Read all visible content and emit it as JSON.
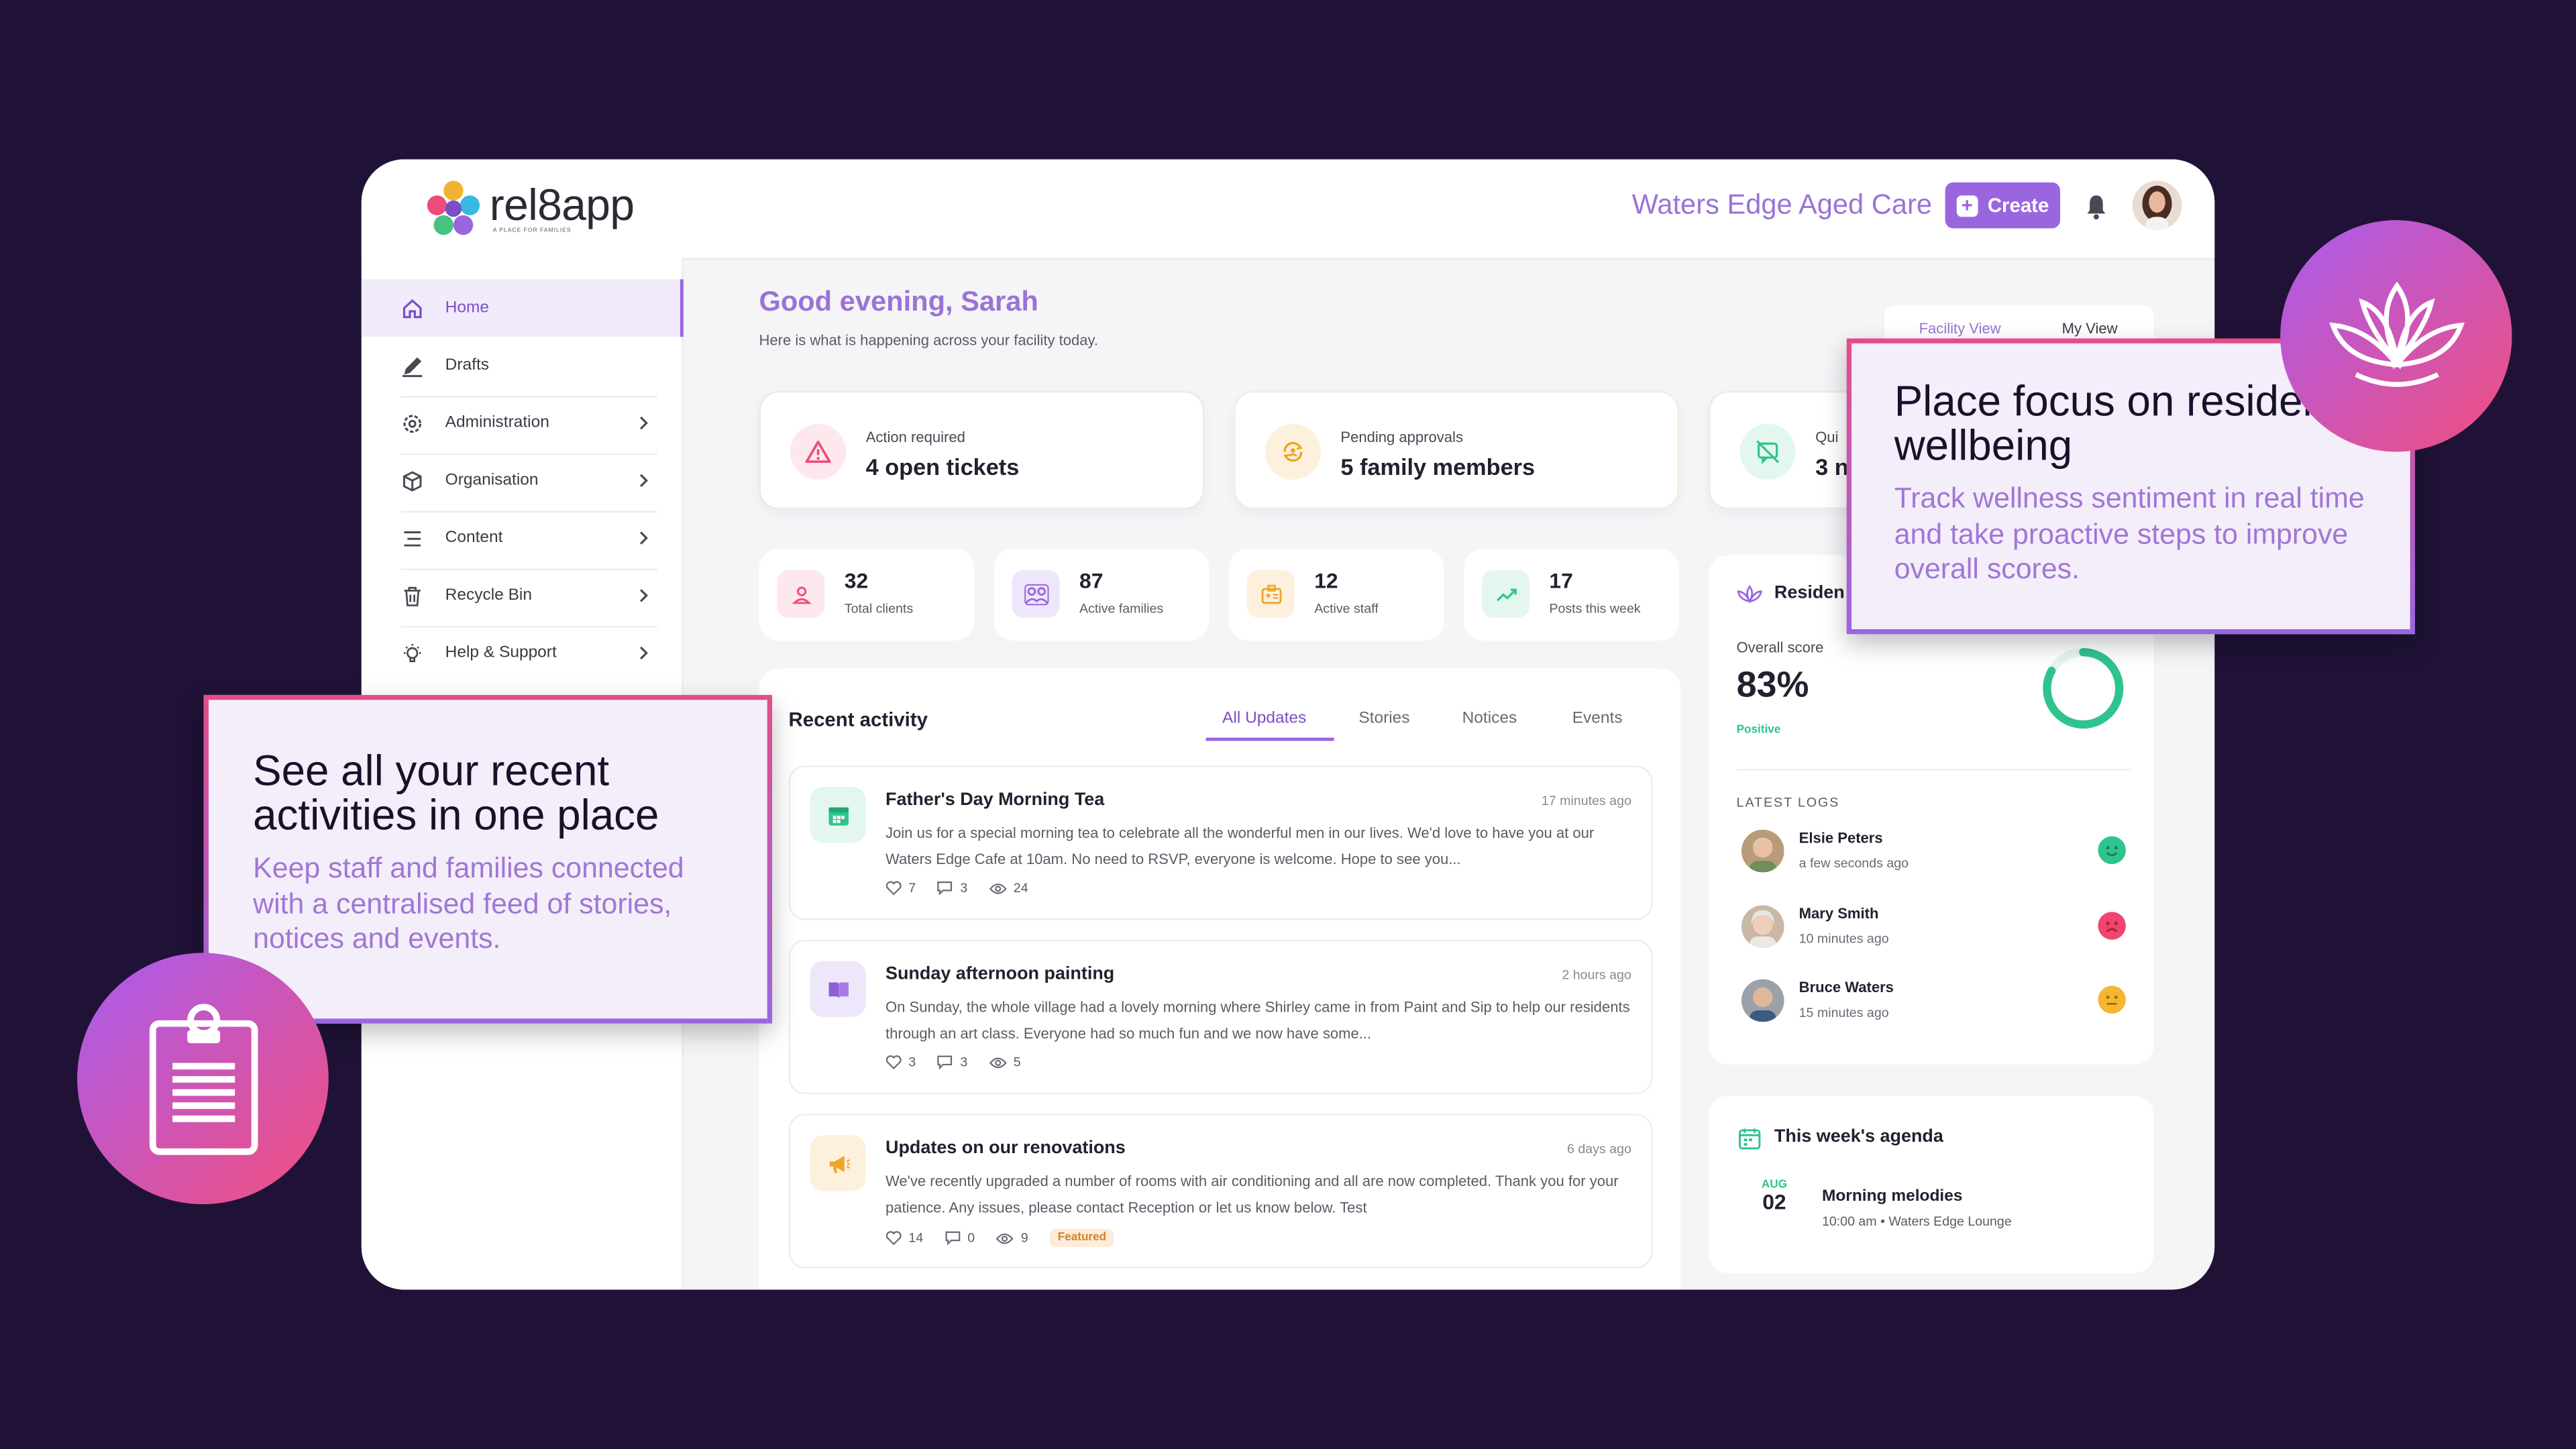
{
  "app": {
    "logo_text": "rel8app",
    "logo_tagline": "A PLACE FOR FAMILIES",
    "facility": "Waters Edge Aged Care",
    "create_label": "Create"
  },
  "sidebar": {
    "items": [
      {
        "label": "Home",
        "icon": "home-icon"
      },
      {
        "label": "Drafts",
        "icon": "pencil-icon"
      },
      {
        "label": "Administration",
        "icon": "gear-icon"
      },
      {
        "label": "Organisation",
        "icon": "cube-icon"
      },
      {
        "label": "Content",
        "icon": "list-icon"
      },
      {
        "label": "Recycle Bin",
        "icon": "trash-icon"
      },
      {
        "label": "Help & Support",
        "icon": "lightbulb-icon"
      }
    ]
  },
  "main": {
    "greeting": "Good evening, Sarah",
    "subtitle": "Here is what is happening across your facility today.",
    "view_toggle": [
      "Facility View",
      "My View"
    ],
    "alerts": [
      {
        "label": "Action required",
        "value": "4 open tickets",
        "icon": "warning-icon"
      },
      {
        "label": "Pending approvals",
        "value": "5 family members",
        "icon": "refresh-user-icon"
      },
      {
        "label": "Qui",
        "value": "3 n",
        "icon": "no-message-icon"
      }
    ],
    "stats": [
      {
        "value": "32",
        "label": "Total clients",
        "icon": "person-icon"
      },
      {
        "value": "87",
        "label": "Active families",
        "icon": "family-icon"
      },
      {
        "value": "12",
        "label": "Active staff",
        "icon": "badge-icon"
      },
      {
        "value": "17",
        "label": "Posts this week",
        "icon": "trend-icon"
      }
    ]
  },
  "activity": {
    "title": "Recent activity",
    "tabs": [
      "All Updates",
      "Stories",
      "Notices",
      "Events"
    ],
    "posts": [
      {
        "title": "Father's Day Morning Tea",
        "time": "17 minutes ago",
        "body": "Join us for a special morning tea to celebrate all the wonderful men in our lives. We'd love to have you at our Waters Edge Cafe at 10am. No need to RSVP, everyone is welcome. Hope to see you...",
        "likes": "7",
        "comments": "3",
        "views": "24",
        "icon": "calendar-icon"
      },
      {
        "title": "Sunday afternoon painting",
        "time": "2 hours ago",
        "body": "On Sunday, the whole village had a lovely morning where Shirley came in from Paint and Sip to help our residents through an art class. Everyone had so much fun and we now have some...",
        "likes": "3",
        "comments": "3",
        "views": "5",
        "icon": "book-icon"
      },
      {
        "title": "Updates on our renovations",
        "time": "6 days ago",
        "body": "We've recently upgraded a number of rooms with air conditioning and all are now completed. Thank you for your patience. Any issues, please contact Reception or let us know below. Test",
        "likes": "14",
        "comments": "0",
        "views": "9",
        "badge": "Featured",
        "icon": "megaphone-icon"
      }
    ]
  },
  "wellbeing": {
    "title": "Residen",
    "overall_label": "Overall score",
    "score": "83%",
    "score_value": 0.83,
    "sentiment": "Positive",
    "logs_heading": "LATEST LOGS",
    "logs": [
      {
        "name": "Elsie Peters",
        "time": "a few seconds ago",
        "mood": "happy",
        "color": "#2fc48d"
      },
      {
        "name": "Mary Smith",
        "time": "10 minutes ago",
        "mood": "sad",
        "color": "#f0456e"
      },
      {
        "name": "Bruce Waters",
        "time": "15 minutes ago",
        "mood": "neutral",
        "color": "#f5b731"
      }
    ]
  },
  "agenda": {
    "title": "This week's agenda",
    "month": "AUG",
    "day": "02",
    "event": "Morning melodies",
    "detail": "10:00 am • Waters Edge Lounge"
  },
  "callouts": {
    "left": {
      "title": "See all your recent activities in one place",
      "subtitle": "Keep staff and families connected with a centralised feed of stories, notices and events."
    },
    "right": {
      "title": "Place focus on resident wellbeing",
      "subtitle": "Track wellness sentiment in real time and take proactive steps to improve overall scores."
    }
  },
  "colors": {
    "background": "#1f1236",
    "accent": "#9a66e0",
    "positive": "#2fc48d"
  }
}
